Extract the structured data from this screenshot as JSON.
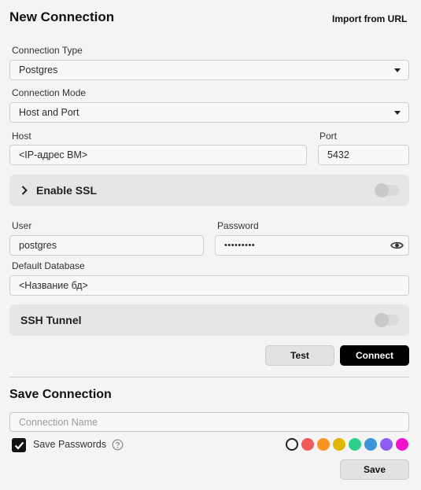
{
  "header": {
    "title": "New Connection",
    "import_label": "Import from URL"
  },
  "connection_type": {
    "label": "Connection Type",
    "value": "Postgres"
  },
  "connection_mode": {
    "label": "Connection Mode",
    "value": "Host and Port"
  },
  "host": {
    "label": "Host",
    "value": "<IP-адрес ВМ>"
  },
  "port": {
    "label": "Port",
    "value": "5432"
  },
  "ssl": {
    "title": "Enable SSL",
    "enabled": false
  },
  "user": {
    "label": "User",
    "value": "postgres"
  },
  "password": {
    "label": "Password",
    "value": "•••••••••"
  },
  "default_database": {
    "label": "Default Database",
    "value": "<Название бд>"
  },
  "ssh": {
    "title": "SSH Tunnel",
    "enabled": false
  },
  "actions": {
    "test_label": "Test",
    "connect_label": "Connect"
  },
  "save_section": {
    "title": "Save Connection",
    "name_placeholder": "Connection Name",
    "save_passwords_label": "Save Passwords",
    "save_passwords_checked": true,
    "save_label": "Save",
    "colors": [
      "none",
      "#f05a5a",
      "#f7941d",
      "#e2b600",
      "#2dd08a",
      "#3b95db",
      "#8f5cf0",
      "#f012cc"
    ]
  }
}
